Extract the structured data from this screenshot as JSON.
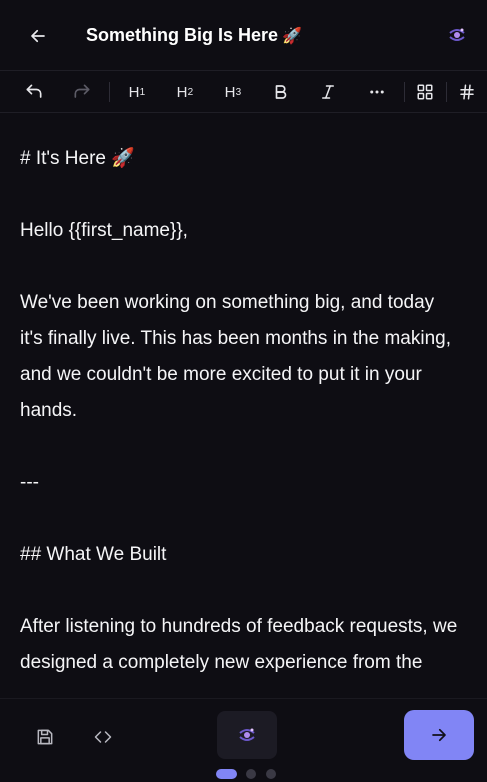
{
  "header": {
    "title": "Something Big Is Here",
    "title_emoji": "🚀",
    "back_icon": "arrow-left-icon",
    "avatar_icon": "galaxy-logo-icon"
  },
  "toolbar": {
    "items": [
      {
        "name": "undo",
        "icon": "undo-icon",
        "enabled": true
      },
      {
        "name": "redo",
        "icon": "redo-icon",
        "enabled": false
      },
      {
        "name": "h1",
        "label": "H",
        "sub": "1"
      },
      {
        "name": "h2",
        "label": "H",
        "sub": "2"
      },
      {
        "name": "h3",
        "label": "H",
        "sub": "3"
      },
      {
        "name": "bold",
        "icon": "bold-icon"
      },
      {
        "name": "italic",
        "icon": "italic-icon"
      },
      {
        "name": "more",
        "icon": "more-horizontal-icon"
      },
      {
        "name": "blocks",
        "icon": "grid-icon"
      },
      {
        "name": "hashtag",
        "icon": "hash-icon"
      }
    ]
  },
  "editor": {
    "lines": [
      "# It's Here 🚀",
      "",
      "Hello {{first_name}},",
      "",
      "We've been working on something big, and today",
      "it's finally live. This has been months in the making,",
      "and we couldn't be more excited to put it in your",
      "hands.",
      "",
      "---",
      "",
      "## What We Built",
      "",
      "After listening to hundreds of feedback requests, we",
      "designed a completely new experience from the"
    ]
  },
  "bottom_bar": {
    "save_icon": "save-icon",
    "code_icon": "code-icon",
    "center_icon": "galaxy-logo-icon",
    "next_icon": "arrow-right-icon",
    "pages": 3,
    "active_page": 1
  },
  "colors": {
    "background": "#0e0d13",
    "accent": "#8185f5",
    "text": "#f5f5f7",
    "muted": "#5c5b66"
  }
}
